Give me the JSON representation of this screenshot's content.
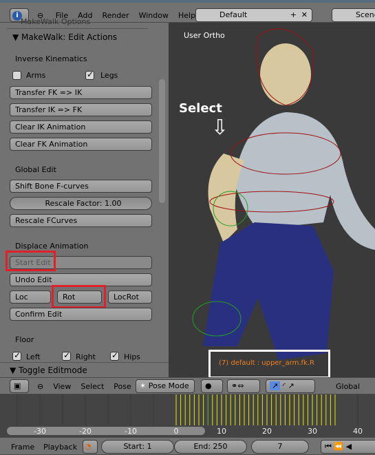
{
  "top_header": {
    "menus": [
      "File",
      "Add",
      "Render",
      "Window",
      "Help"
    ],
    "layout": "Default",
    "scene": "Scene"
  },
  "panel": {
    "hidden_header": "MakeWalk Options",
    "title": "MakeWalk: Edit Actions",
    "ik_label": "Inverse Kinematics",
    "arms": "Arms",
    "legs": "Legs",
    "arms_checked": false,
    "legs_checked": true,
    "buttons": [
      "Transfer FK => IK",
      "Transfer IK => FK",
      "Clear IK Animation",
      "Clear FK Animation"
    ],
    "global_edit": "Global Edit",
    "shift_bone": "Shift Bone F-curves",
    "rescale_factor": "Rescale Factor: 1.00",
    "rescale_fcurves": "Rescale FCurves",
    "displace": "Displace Animation",
    "start_edit": "Start Edit",
    "undo_edit": "Undo Edit",
    "loc": "Loc",
    "rot": "Rot",
    "locrot": "LocRot",
    "confirm_edit": "Confirm Edit",
    "floor": "Floor",
    "left": "Left",
    "right": "Right",
    "hips": "Hips",
    "toggle_editmode": "Toggle Editmode"
  },
  "viewport": {
    "view_label": "User Ortho",
    "annotation": "Select",
    "status": "(7) default : upper_arm.fk.R"
  },
  "view_header": {
    "menus": [
      "View",
      "Select",
      "Pose"
    ],
    "mode": "Pose Mode",
    "orientation": "Global"
  },
  "timeline": {
    "ticks": [
      "-30",
      "-20",
      "-10",
      "0",
      "10",
      "20",
      "30",
      "40"
    ],
    "current_frame": 7,
    "keyframes_from": 0,
    "keyframes_to": 35
  },
  "timeline_header": {
    "menus": [
      "Frame",
      "Playback"
    ],
    "start": "Start: 1",
    "end": "End: 250",
    "frame": "7"
  },
  "colors": {
    "highlight": "#e0202a",
    "keyframe": "#e8e800",
    "current": "#60c020",
    "status_text": "#f08020"
  }
}
